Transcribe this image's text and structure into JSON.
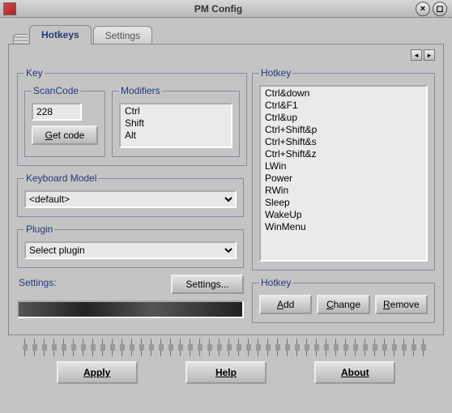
{
  "window": {
    "title": "PM Config"
  },
  "tabs": {
    "hotkeys": "Hotkeys",
    "settings": "Settings"
  },
  "groups": {
    "key": "Key",
    "scancode": "ScanCode",
    "modifiers": "Modifiers",
    "keyboard_model": "Keyboard Model",
    "plugin": "Plugin",
    "hotkey_list": "Hotkey",
    "hotkey_actions": "Hotkey"
  },
  "scancode": {
    "value": "228",
    "get_code_btn": "Get code"
  },
  "modifiers": [
    "Ctrl",
    "Shift",
    "Alt"
  ],
  "keyboard_model": {
    "value": "<default>"
  },
  "plugin": {
    "value": "Select plugin",
    "settings_btn": "Settings..."
  },
  "settings_label": "Settings:",
  "hotkeys": [
    "Ctrl&down",
    "Ctrl&F1",
    "Ctrl&up",
    "Ctrl+Shift&p",
    "Ctrl+Shift&s",
    "Ctrl+Shift&z",
    "LWin",
    "Power",
    "RWin",
    "Sleep",
    "WakeUp",
    "WinMenu"
  ],
  "hotkey_buttons": {
    "add": "Add",
    "change": "Change",
    "remove": "Remove"
  },
  "bottom_buttons": {
    "apply": "Apply",
    "help": "Help",
    "about": "About"
  }
}
